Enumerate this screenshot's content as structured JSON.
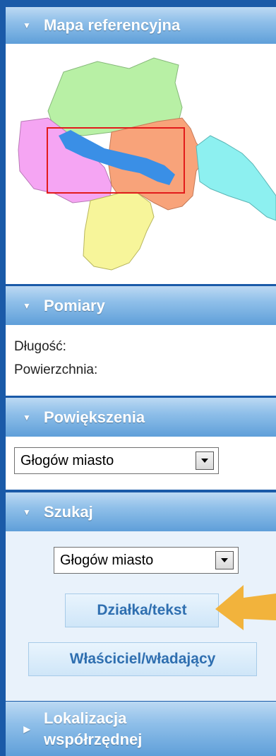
{
  "sections": {
    "map": {
      "title": "Mapa referencyjna",
      "icon": "triangle-down-icon"
    },
    "measure": {
      "title": "Pomiary",
      "length_label": "Długość:",
      "area_label": "Powierzchnia:"
    },
    "zoom": {
      "title": "Powiększenia",
      "select_value": "Głogów miasto"
    },
    "search": {
      "title": "Szukaj",
      "select_value": "Głogów miasto",
      "parcel_button": "Działka/tekst",
      "owner_button": "Właściciel/władający"
    },
    "coords": {
      "title_line1": "Lokalizacja",
      "title_line2": "współrzędnej",
      "icon": "triangle-right-icon"
    }
  },
  "colors": {
    "header_gradient_top": "#bcd9f3",
    "header_gradient_bottom": "#5f9fd9",
    "link_text": "#2f6fb0",
    "callout_arrow": "#f2b33c"
  }
}
